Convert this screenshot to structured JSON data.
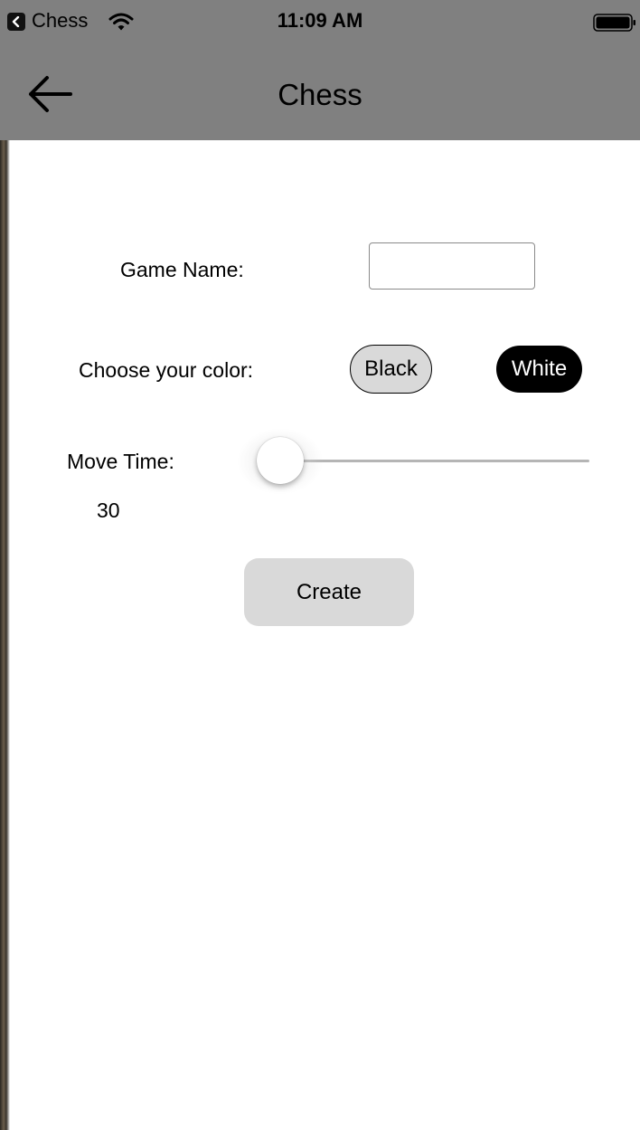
{
  "status_bar": {
    "back_app": "Chess",
    "time": "11:09 AM",
    "icons": [
      "back-badge-icon",
      "wifi-icon",
      "battery-icon"
    ]
  },
  "nav": {
    "title": "Chess",
    "back_icon": "arrow-left-icon"
  },
  "form": {
    "game_name_label": "Game Name:",
    "game_name_value": "",
    "color_label": "Choose your color:",
    "color_options": [
      "Black",
      "White"
    ],
    "selected_color": "White",
    "move_time_label": "Move Time:",
    "move_time_value": "30",
    "slider_level": 0,
    "create_label": "Create"
  },
  "colors": {
    "bar_background": "#808080",
    "button_gray": "#d9d9d9",
    "selected_pill": "#000000"
  }
}
